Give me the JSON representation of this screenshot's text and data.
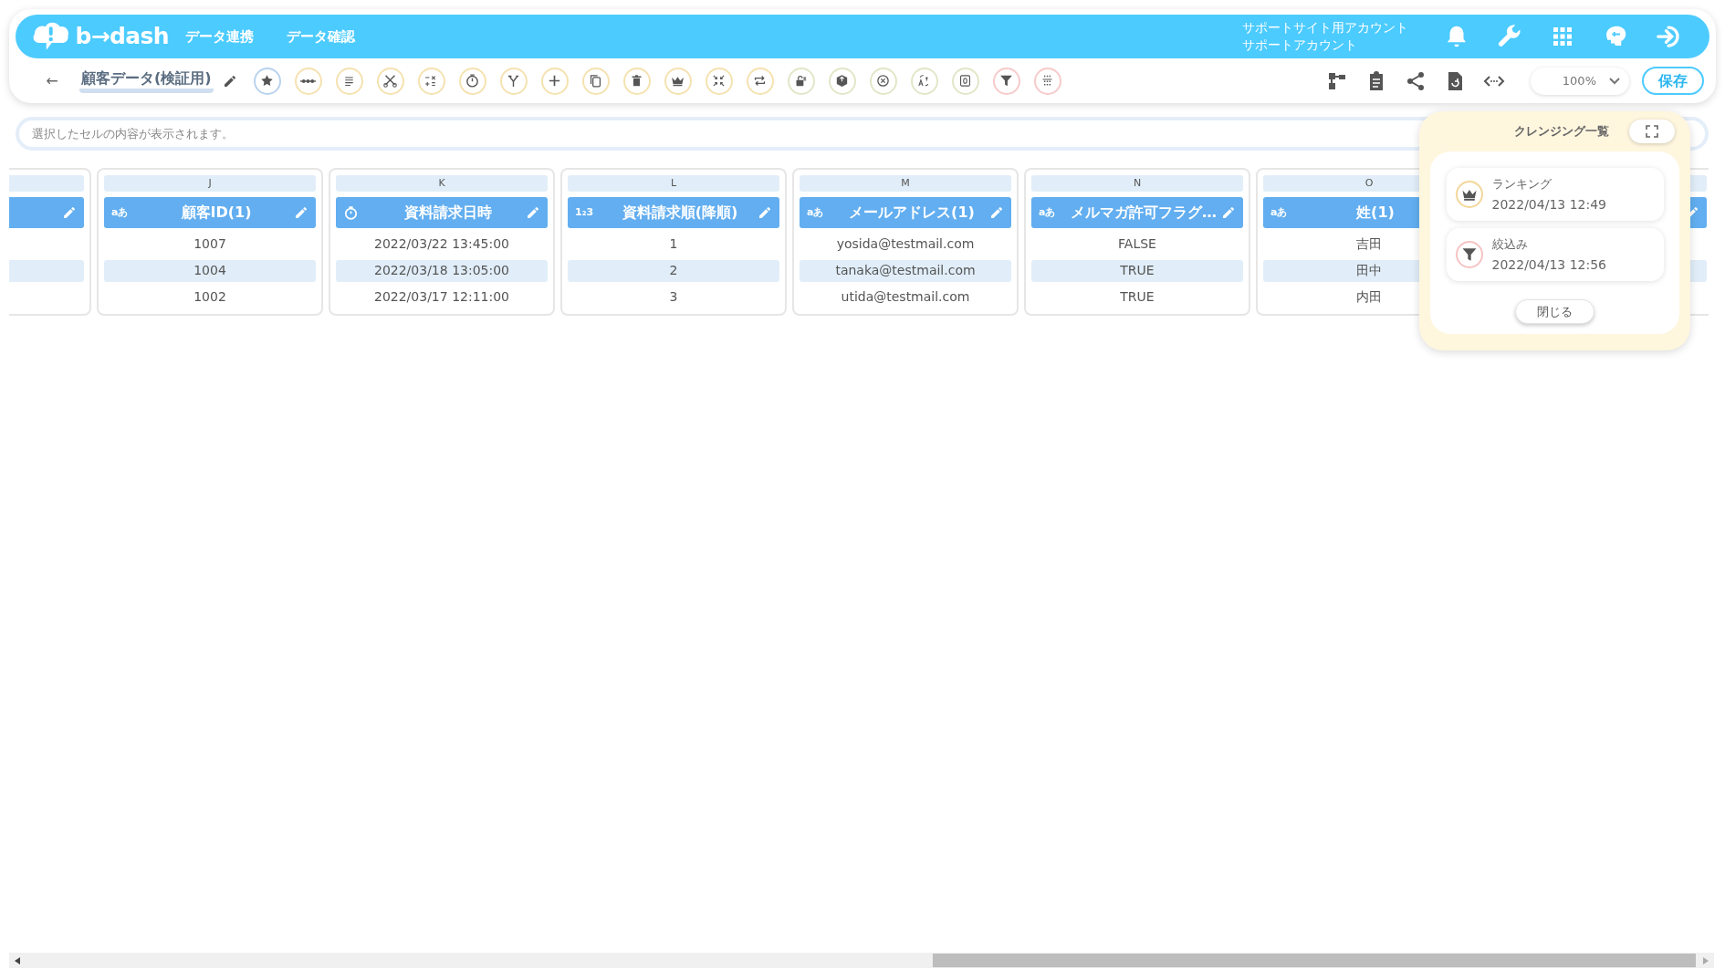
{
  "header": {
    "logo": "b→dash",
    "nav": [
      "データ連携",
      "データ確認"
    ],
    "account": [
      "サポートサイト用アカウント",
      "サポートアカウント"
    ],
    "icons": [
      {
        "kind": "bell"
      },
      {
        "kind": "wrench"
      },
      {
        "kind": "apps"
      },
      {
        "kind": "head"
      },
      {
        "kind": "logout"
      }
    ]
  },
  "toolbar": {
    "back": "←",
    "title": "顧客データ(検証用)",
    "tools": [
      {
        "kind": "star",
        "color": "#b9d3ee"
      },
      {
        "kind": "dots",
        "color": "#f5e2b0"
      },
      {
        "kind": "lines",
        "color": "#f5e2b0"
      },
      {
        "kind": "scissors",
        "color": "#f5e2b0"
      },
      {
        "kind": "calc",
        "color": "#f5e2b0"
      },
      {
        "kind": "timer",
        "color": "#f5e2b0"
      },
      {
        "kind": "fork",
        "color": "#f5e2b0"
      },
      {
        "kind": "plus",
        "color": "#f5e2b0"
      },
      {
        "kind": "copy",
        "color": "#f5e2b0"
      },
      {
        "kind": "trash",
        "color": "#f5e2b0"
      },
      {
        "kind": "crown",
        "color": "#f5e2b0"
      },
      {
        "kind": "compress",
        "color": "#f5e2b0"
      },
      {
        "kind": "repeat",
        "color": "#f5e2b0"
      },
      {
        "kind": "lock",
        "color": "#e2e6c8"
      },
      {
        "kind": "box",
        "color": "#e2e6c8"
      },
      {
        "kind": "xcircle",
        "color": "#e2e6c8"
      },
      {
        "kind": "translate",
        "color": "#e2e6c8"
      },
      {
        "kind": "zero",
        "color": "#e2e6c8"
      },
      {
        "kind": "filter",
        "color": "#f7caca"
      },
      {
        "kind": "grid",
        "color": "#f7caca"
      }
    ],
    "right_icons": [
      {
        "kind": "flow"
      },
      {
        "kind": "clipboard"
      },
      {
        "kind": "share"
      },
      {
        "kind": "filerefresh"
      },
      {
        "kind": "code"
      }
    ],
    "zoom": "100%",
    "save": "保存"
  },
  "cell_bar": {
    "placeholder": "選択したセルの内容が表示されます。"
  },
  "columns": [
    {
      "kind": "clipped"
    },
    {
      "kind": "column",
      "letter": "J",
      "type_icon": {
        "kind": "label",
        "label": "aあ"
      },
      "title": "顧客ID(1)",
      "cells": [
        "1007",
        "1004",
        "1002"
      ]
    },
    {
      "kind": "column",
      "letter": "K",
      "type_icon": {
        "kind": "timer"
      },
      "title": "資料請求日時",
      "cells": [
        "2022/03/22 13:45:00",
        "2022/03/18 13:05:00",
        "2022/03/17 12:11:00"
      ]
    },
    {
      "kind": "column",
      "letter": "L",
      "type_icon": {
        "kind": "label",
        "label": "1₂3"
      },
      "title": "資料請求順(降順)",
      "cells": [
        "1",
        "2",
        "3"
      ]
    },
    {
      "kind": "column",
      "letter": "M",
      "type_icon": {
        "kind": "label",
        "label": "aあ"
      },
      "title": "メールアドレス(1)",
      "cells": [
        "yosida@testmail.com",
        "tanaka@testmail.com",
        "utida@testmail.com"
      ]
    },
    {
      "kind": "column",
      "letter": "N",
      "type_icon": {
        "kind": "label",
        "label": "aあ"
      },
      "title": "メルマガ許可フラグ…",
      "cells": [
        "FALSE",
        "TRUE",
        "TRUE"
      ]
    },
    {
      "kind": "column_under_panel",
      "letter": "O",
      "type_icon": {
        "kind": "label",
        "label": "aあ"
      },
      "title": "姓(1)",
      "cells": [
        "吉田",
        "田中",
        "内田"
      ]
    },
    {
      "kind": "clipped"
    }
  ],
  "cleansing_panel": {
    "title": "クレンジング一覧",
    "items": [
      {
        "kind": "crown",
        "name": "ランキング",
        "time": "2022/04/13 12:49",
        "color": "#f3d79a"
      },
      {
        "kind": "filter",
        "name": "絞込み",
        "time": "2022/04/13 12:56",
        "color": "#f6c3c3"
      }
    ],
    "close": "閉じる"
  }
}
